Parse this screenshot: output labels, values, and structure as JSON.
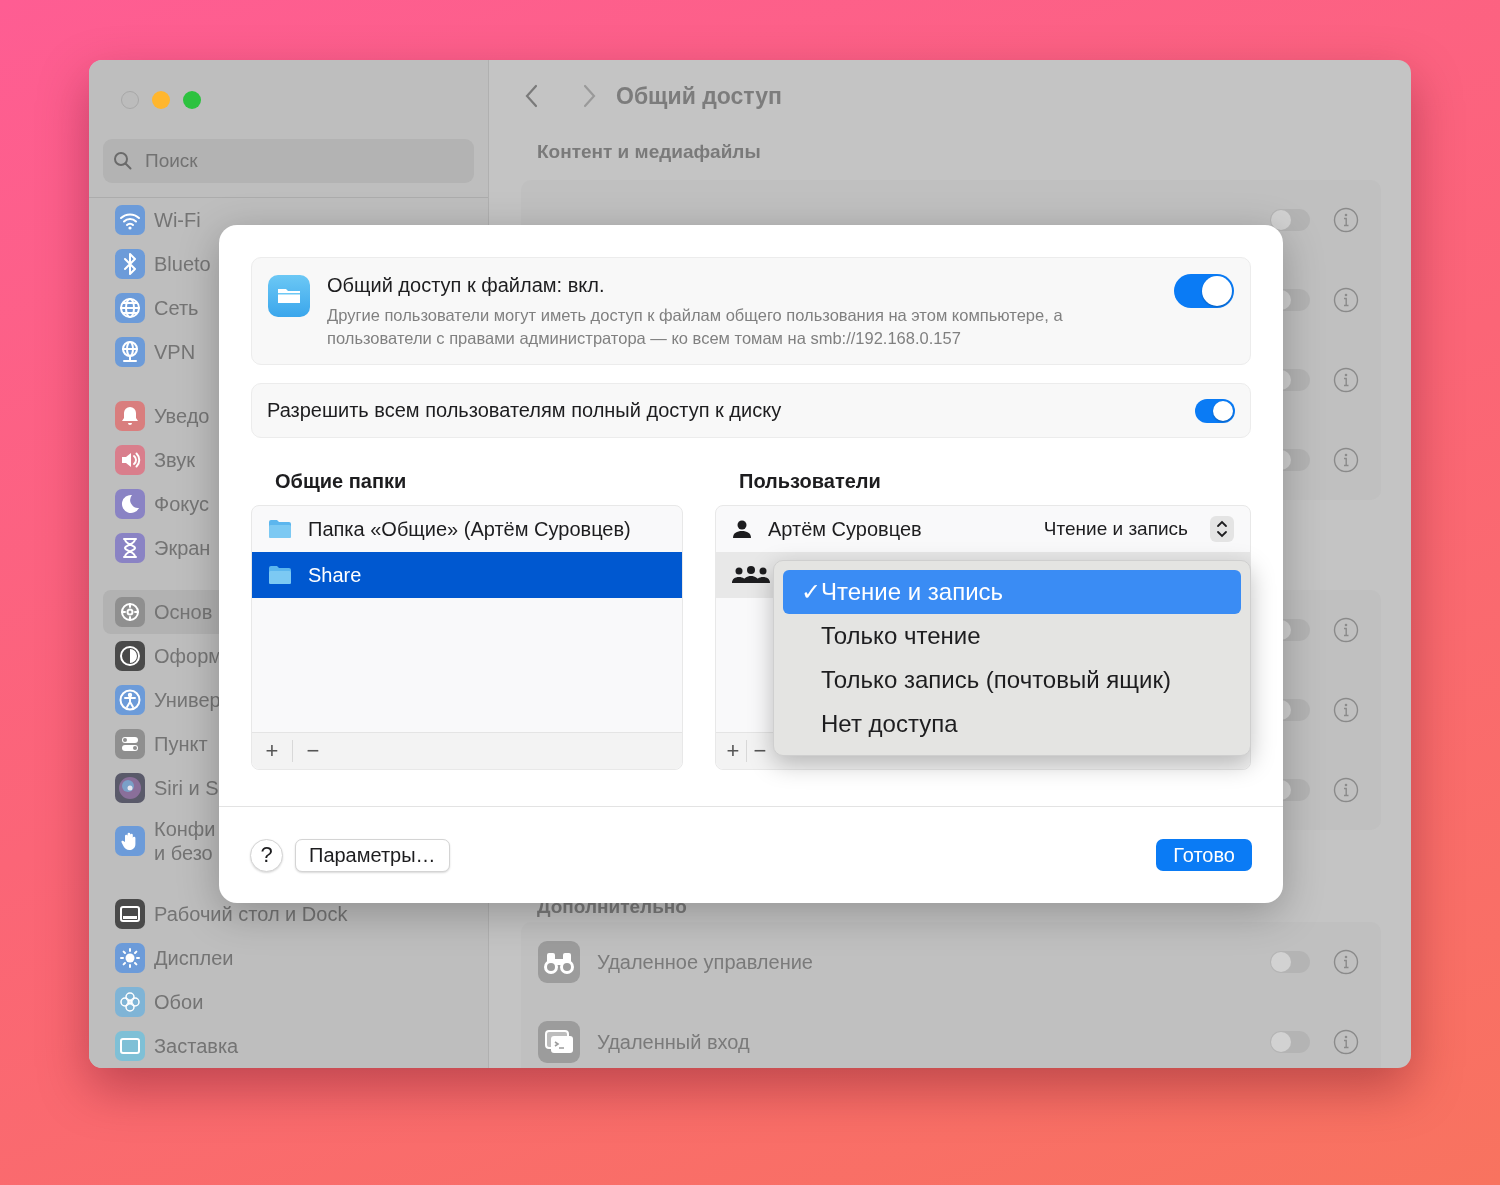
{
  "window": {
    "title": "Общий доступ"
  },
  "sidebar": {
    "search": {
      "placeholder": "Поиск"
    },
    "groups": [
      [
        {
          "label": "Wi-Fi",
          "selected": false
        },
        {
          "label": "Blueto",
          "selected": false
        },
        {
          "label": "Сеть",
          "selected": false
        },
        {
          "label": "VPN",
          "selected": false
        }
      ],
      [
        {
          "label": "Уведо",
          "selected": false
        },
        {
          "label": "Звук",
          "selected": false
        },
        {
          "label": "Фокус",
          "selected": false
        },
        {
          "label": "Экран",
          "selected": false
        }
      ],
      [
        {
          "label": "Основ",
          "selected": true
        },
        {
          "label": "Оформ",
          "selected": false
        },
        {
          "label": "Универ",
          "selected": false
        },
        {
          "label": "Пункт",
          "selected": false
        },
        {
          "label": "Siri и S",
          "selected": false
        },
        {
          "label": "Конфи\nи безо",
          "selected": false
        }
      ],
      [
        {
          "label": "Рабочий стол и Dock",
          "selected": false
        },
        {
          "label": "Дисплеи",
          "selected": false
        },
        {
          "label": "Обои",
          "selected": false
        },
        {
          "label": "Заставка",
          "selected": false
        }
      ]
    ]
  },
  "sections": [
    {
      "heading": "Контент и медиафайлы",
      "rows": [
        {
          "on": false
        },
        {
          "on": false
        },
        {
          "on": false
        },
        {
          "on": false
        }
      ]
    },
    {
      "rows": [
        {
          "on": false
        },
        {
          "on": false
        },
        {
          "on": false
        }
      ]
    },
    {
      "heading": "Дополнительно",
      "rows": [
        {
          "label": "Удаленное управление",
          "on": false
        },
        {
          "label": "Удаленный вход",
          "on": false
        }
      ]
    }
  ],
  "dialog": {
    "file_sharing": {
      "title": "Общий доступ к файлам: вкл.",
      "description": "Другие пользователи могут иметь доступ к файлам общего пользования на этом компьютере, а пользователи с правами администратора — ко всем томам на smb://192.168.0.157",
      "on": true
    },
    "full_disk_access": {
      "label": "Разрешить всем пользователям полный доступ к диску",
      "on": true
    },
    "folders": {
      "heading": "Общие папки",
      "items": [
        {
          "label": "Папка «Общие» (Артём Суровцев)",
          "selected": false
        },
        {
          "label": "Share",
          "selected": true
        }
      ],
      "add": "+",
      "remove": "−"
    },
    "users": {
      "heading": "Пользователи",
      "items": [
        {
          "kind": "user",
          "name": "Артём Суровцев",
          "permission": "Чтение и запись",
          "selected": false
        },
        {
          "kind": "group",
          "selected": true
        }
      ],
      "add": "+",
      "remove": "−"
    },
    "permission_menu": {
      "checkmark": "✓",
      "items": [
        {
          "label": "Чтение и запись",
          "selected": true
        },
        {
          "label": "Только чтение",
          "selected": false
        },
        {
          "label": "Только запись (почтовый ящик)",
          "selected": false
        },
        {
          "label": "Нет доступа",
          "selected": false
        }
      ]
    },
    "help": "?",
    "options": "Параметры…",
    "done": "Готово"
  }
}
